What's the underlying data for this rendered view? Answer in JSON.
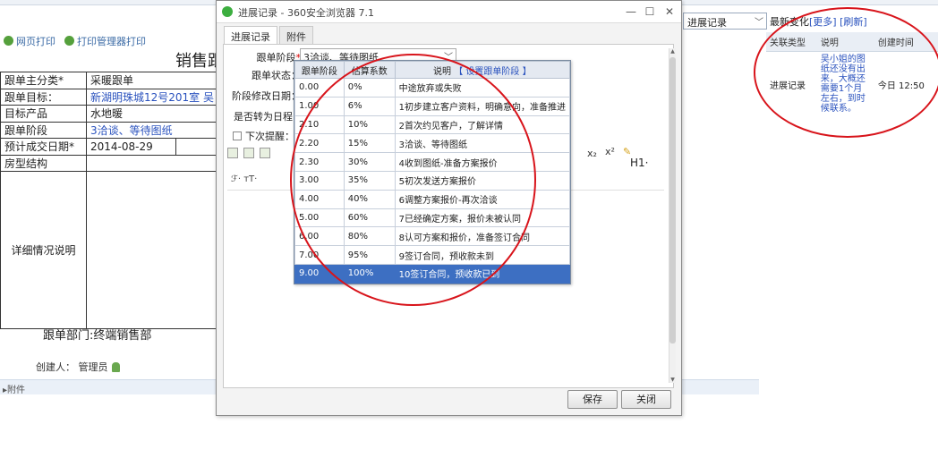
{
  "background": {
    "print_links": [
      "网页打印",
      "打印管理器打印"
    ],
    "page_title": "销售跟",
    "rows": [
      {
        "label": "跟单主分类*",
        "value": "采暖跟单",
        "link": false
      },
      {
        "label": "跟单目标：",
        "value": "新湖明珠城12号201室 吴",
        "link": true
      },
      {
        "label": "目标产品",
        "value": "水地暖",
        "link": false
      },
      {
        "label": "跟单阶段",
        "value": "3洽谈、等待图纸",
        "link": true
      },
      {
        "label": "预计成交日期*",
        "value": "2014-08-29",
        "link": false
      },
      {
        "label": "房型结构",
        "value": "",
        "link": false
      }
    ],
    "detail_label": "详细情况说明",
    "dept": "跟单部门:终端销售部",
    "creator_label": "创建人：",
    "creator_name": "管理员",
    "attachment_label": "▸附件",
    "right_select": "进展记录",
    "recent_title": "最新变化",
    "recent_more": "[更多]",
    "recent_refresh": "[刷新]",
    "recent_headers": [
      "关联类型",
      "说明",
      "创建时间"
    ],
    "recent_row": {
      "type": "进展记录",
      "note": "吴小姐的图纸还没有出来，大概还需要1个月左右，到时候联系。",
      "time": "今日 12:50"
    }
  },
  "window": {
    "title": "进展记录 - 360安全浏览器 7.1",
    "controls": [
      "—",
      "☐",
      "✕"
    ],
    "tabs": [
      "进展记录",
      "附件"
    ],
    "stage_label": "跟单阶段",
    "stage_value": "3洽谈、等待图纸",
    "status_label": "跟单状态：",
    "date_label": "阶段修改日期：",
    "schedule_label": "是否转为日程：",
    "remind_label": "下次提醒：",
    "toolbar_h1": "H1·",
    "toolbar_fonts": "ℱ· ᴛT·",
    "save_button": "保存",
    "close_button": "关闭"
  },
  "dropdown": {
    "headers": [
      "跟单阶段",
      "估算系数",
      "说明"
    ],
    "header_link": "【 设置跟单阶段 】",
    "rows": [
      {
        "stage": "0.00",
        "coef": "0%",
        "desc": "中途放弃或失败"
      },
      {
        "stage": "1.00",
        "coef": "6%",
        "desc": "1初步建立客户资料，明确意向，准备推进"
      },
      {
        "stage": "2.10",
        "coef": "10%",
        "desc": "2首次约见客户，了解详情"
      },
      {
        "stage": "2.20",
        "coef": "15%",
        "desc": "3洽谈、等待图纸"
      },
      {
        "stage": "2.30",
        "coef": "30%",
        "desc": "4收到图纸-准备方案报价"
      },
      {
        "stage": "3.00",
        "coef": "35%",
        "desc": "5初次发送方案报价"
      },
      {
        "stage": "4.00",
        "coef": "40%",
        "desc": "6调整方案报价-再次洽谈"
      },
      {
        "stage": "5.00",
        "coef": "60%",
        "desc": "7已经确定方案，报价未被认同"
      },
      {
        "stage": "6.00",
        "coef": "80%",
        "desc": "8认可方案和报价，准备签订合同"
      },
      {
        "stage": "7.00",
        "coef": "95%",
        "desc": "9签订合同，预收款未到"
      },
      {
        "stage": "9.00",
        "coef": "100%",
        "desc": "10签订合同，预收款已到"
      }
    ],
    "selected_index": 10
  }
}
